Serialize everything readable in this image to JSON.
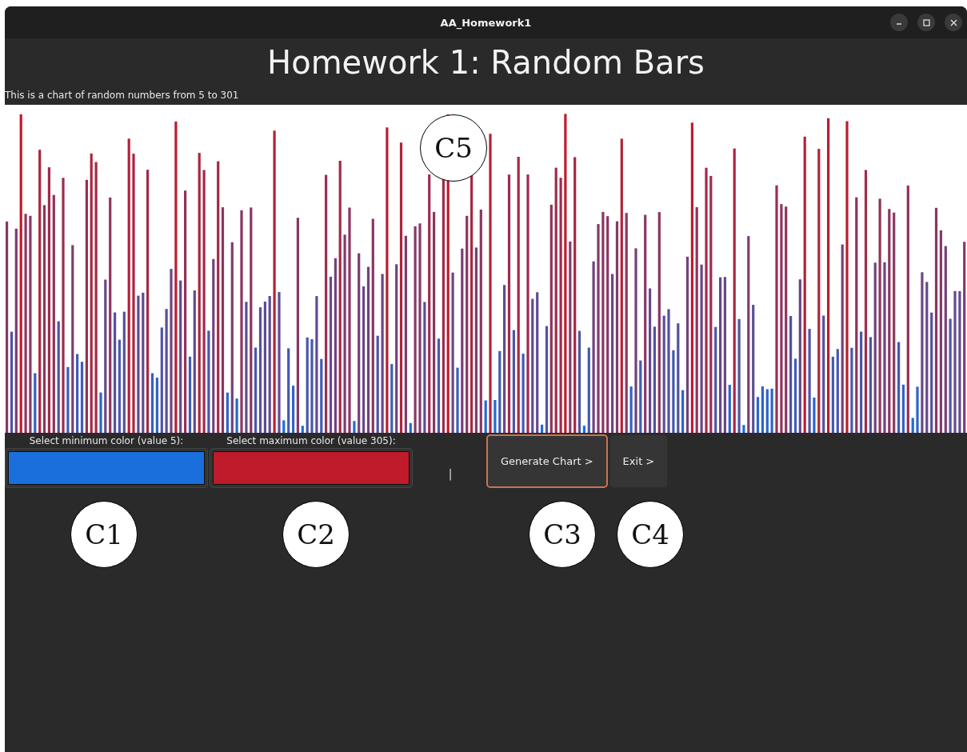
{
  "window": {
    "title": "AA_Homework1"
  },
  "heading": "Homework 1: Random Bars",
  "chart": {
    "caption": "This is a chart of random numbers from 5 to 301"
  },
  "color_pickers": [
    {
      "label": "Select minimum color (value 5):",
      "color": "#1a6fdc"
    },
    {
      "label": "Select maximum color (value 305):",
      "color": "#bf1b2a"
    }
  ],
  "status_text": "|",
  "buttons": [
    {
      "label": "Generate Chart >",
      "focused": true
    },
    {
      "label": "Exit >",
      "focused": false
    }
  ],
  "callouts": [
    {
      "label": "C1"
    },
    {
      "label": "C2"
    },
    {
      "label": "C3"
    },
    {
      "label": "C4"
    },
    {
      "label": "C5"
    }
  ]
}
